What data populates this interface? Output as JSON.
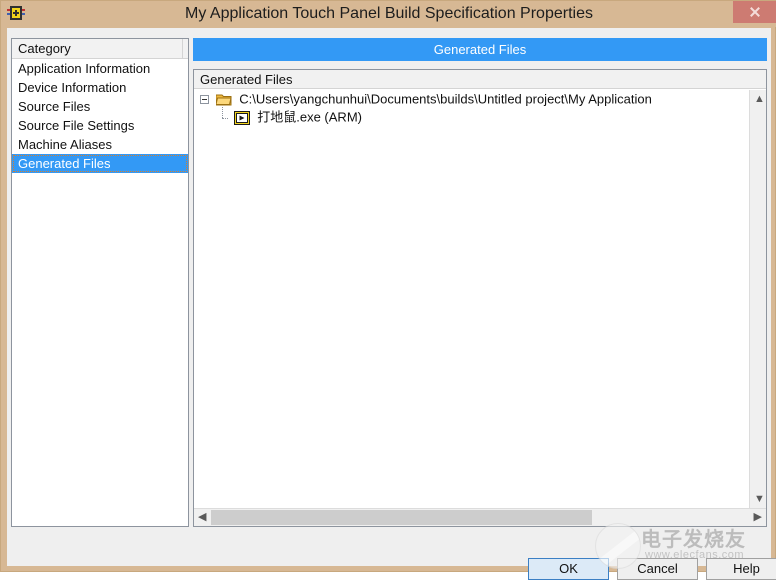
{
  "window": {
    "title": "My Application Touch Panel Build Specification Properties",
    "icon": "labview-vi-icon",
    "close_label": "close-icon",
    "frame_color": "#d7b894",
    "client_color": "#efefef"
  },
  "category_panel": {
    "header": "Category",
    "selected_index": 5,
    "items": [
      {
        "label": "Application Information"
      },
      {
        "label": "Device Information"
      },
      {
        "label": "Source Files"
      },
      {
        "label": "Source File Settings"
      },
      {
        "label": "Machine Aliases"
      },
      {
        "label": "Generated Files"
      }
    ]
  },
  "right_pane": {
    "banner_title": "Generated Files",
    "banner_color": "#3399f5",
    "tree_header": "Generated Files",
    "tree": [
      {
        "level": 0,
        "icon": "folder-icon",
        "expander": "minus",
        "label": "C:\\Users\\yangchunhui\\Documents\\builds\\Untitled project\\My Application"
      },
      {
        "level": 1,
        "icon": "vi-exe-icon",
        "expander": "none",
        "label": "打地鼠.exe (ARM)"
      }
    ],
    "scrollbars": {
      "vertical_up": "▲",
      "vertical_down": "▼",
      "horizontal_left": "◀",
      "horizontal_right": "▶"
    }
  },
  "buttons": {
    "ok": "OK",
    "cancel": "Cancel",
    "help": "Help"
  },
  "watermark": {
    "text": "电子发烧友",
    "url": "www.elecfans.com"
  }
}
